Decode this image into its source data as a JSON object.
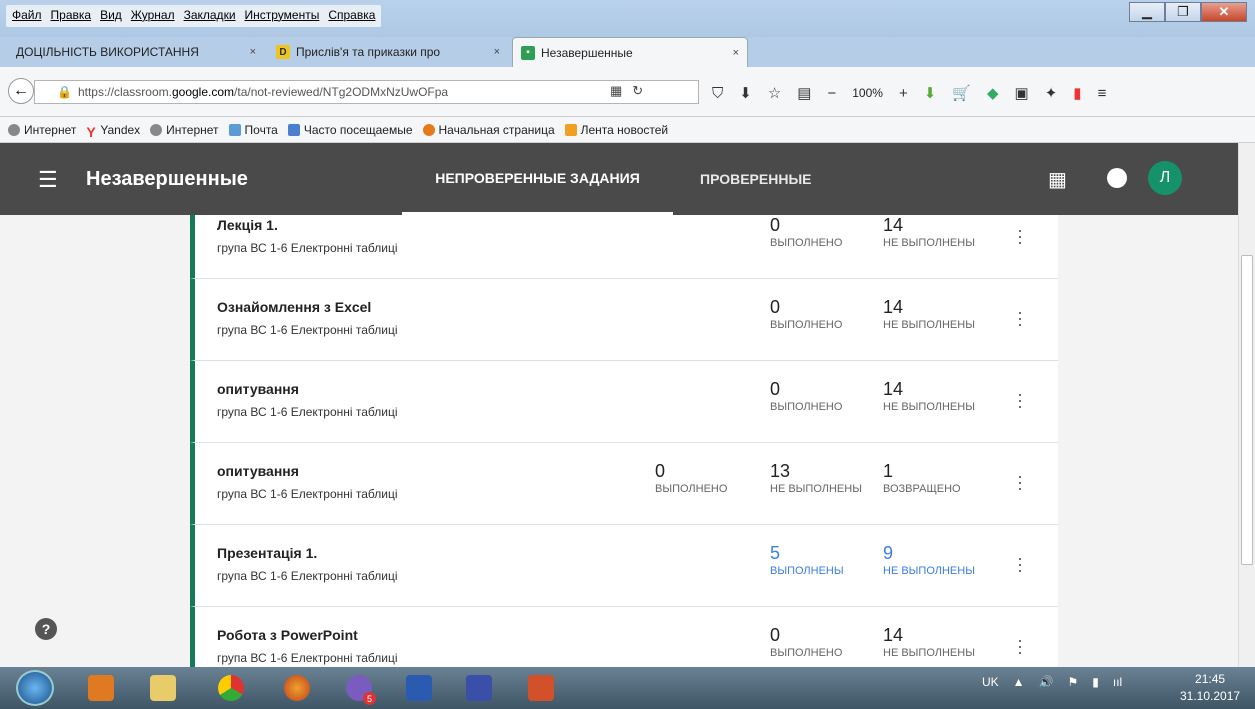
{
  "window": {
    "menu": [
      "Файл",
      "Правка",
      "Вид",
      "Журнал",
      "Закладки",
      "Инструменты",
      "Справка"
    ]
  },
  "tabs": [
    {
      "label": "ДОЦІЛЬНІСТЬ ВИКОРИСТАННЯ",
      "close": "×"
    },
    {
      "label": "Прислів'я та приказки про",
      "close": "×"
    },
    {
      "label": "Незавершенные",
      "close": "×"
    }
  ],
  "newtab": "+",
  "nav": {
    "url_prefix": "https://classroom.",
    "url_domain": "google.com",
    "url_path": "/ta/not-reviewed/NTg2ODMxNzUwOFpa",
    "zoom": "100%"
  },
  "bookmarks": [
    "Интернет",
    "Yandex",
    "Интернет",
    "Почта",
    "Часто посещаемые",
    "Начальная страница",
    "Лента новостей"
  ],
  "appbar": {
    "title": "Незавершенные",
    "tab_unreviewed": "НЕПРОВЕРЕННЫЕ ЗАДАНИЯ",
    "tab_reviewed": "ПРОВЕРЕННЫЕ",
    "avatar_letter": "Л"
  },
  "assignments": [
    {
      "title": "Лекція 1.",
      "subtitle": "група ВС 1-6 Електронні таблиці",
      "stats": [
        {
          "num": "0",
          "label": "ВЫПОЛНЕНО"
        },
        {
          "num": "14",
          "label": "НЕ ВЫПОЛНЕНЫ"
        }
      ]
    },
    {
      "title": "Ознайомлення з Excel",
      "subtitle": "група ВС 1-6 Електронні таблиці",
      "stats": [
        {
          "num": "0",
          "label": "ВЫПОЛНЕНО"
        },
        {
          "num": "14",
          "label": "НЕ ВЫПОЛНЕНЫ"
        }
      ]
    },
    {
      "title": "опитування",
      "subtitle": "група ВС 1-6 Електронні таблиці",
      "stats": [
        {
          "num": "0",
          "label": "ВЫПОЛНЕНО"
        },
        {
          "num": "14",
          "label": "НЕ ВЫПОЛНЕНЫ"
        }
      ]
    },
    {
      "title": "опитування",
      "subtitle": "група ВС 1-6 Електронні таблиці",
      "stats": [
        {
          "num": "0",
          "label": "ВЫПОЛНЕНО"
        },
        {
          "num": "13",
          "label": "НЕ ВЫПОЛНЕНЫ"
        },
        {
          "num": "1",
          "label": "ВОЗВРАЩЕНО"
        }
      ]
    },
    {
      "title": "Презентація 1.",
      "subtitle": "група ВС 1-6 Електронні таблиці",
      "stats": [
        {
          "num": "5",
          "label": "ВЫПОЛНЕНЫ"
        },
        {
          "num": "9",
          "label": "НЕ ВЫПОЛНЕНЫ"
        }
      ]
    },
    {
      "title": "Робота з PowerPoint",
      "subtitle": "група ВС 1-6 Електронні таблиці",
      "stats": [
        {
          "num": "0",
          "label": "ВЫПОЛНЕНО"
        },
        {
          "num": "14",
          "label": "НЕ ВЫПОЛНЕНЫ"
        }
      ]
    }
  ],
  "help": "?",
  "taskbar": {
    "lang": "UK",
    "time": "21:45",
    "date": "31.10.2017",
    "viber_badge": "5"
  },
  "colors": {
    "accent": "#16785a",
    "link": "#3b7ee6",
    "appbar": "#4a4a4a"
  }
}
